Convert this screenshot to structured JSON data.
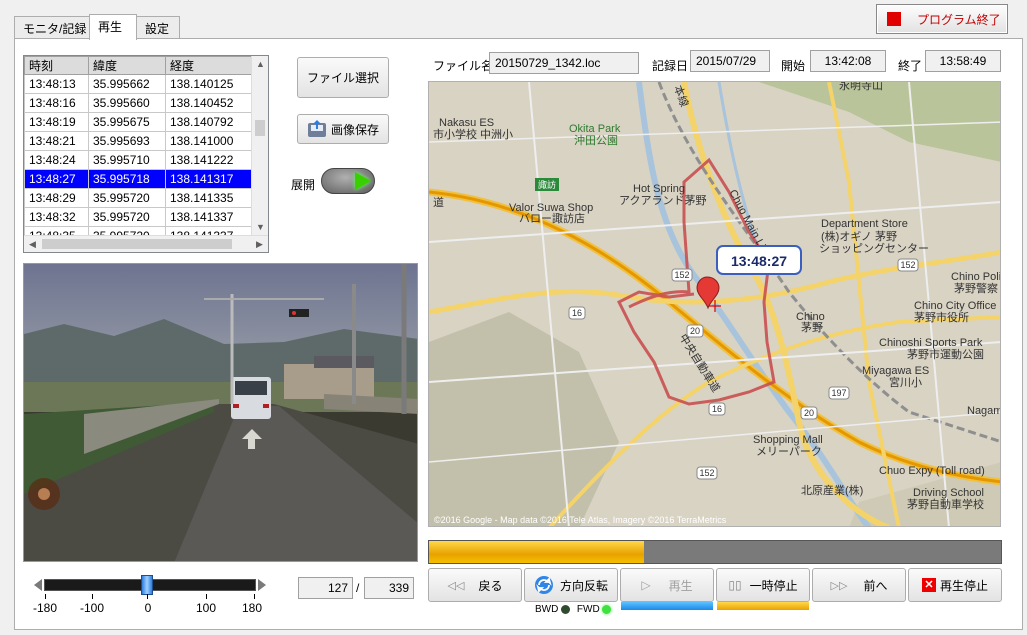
{
  "tabs": [
    {
      "label": "モニタ/記録",
      "active": false
    },
    {
      "label": "再生",
      "active": true
    },
    {
      "label": "設定",
      "active": false
    }
  ],
  "exit_button": {
    "label": "プログラム終了"
  },
  "grid": {
    "headers": [
      "時刻",
      "緯度",
      "経度"
    ],
    "rows": [
      [
        "13:48:13",
        "35.995662",
        "138.140125"
      ],
      [
        "13:48:16",
        "35.995660",
        "138.140452"
      ],
      [
        "13:48:19",
        "35.995675",
        "138.140792"
      ],
      [
        "13:48:21",
        "35.995693",
        "138.141000"
      ],
      [
        "13:48:24",
        "35.995710",
        "138.141222"
      ],
      [
        "13:48:27",
        "35.995718",
        "138.141317"
      ],
      [
        "13:48:29",
        "35.995720",
        "138.141335"
      ],
      [
        "13:48:32",
        "35.995720",
        "138.141337"
      ],
      [
        "13:48:35",
        "35.995720",
        "138.141337"
      ]
    ],
    "selected_index": 5
  },
  "buttons": {
    "file_select": "ファイル選択",
    "image_save": "画像保存",
    "expand_label": "展開"
  },
  "file_info": {
    "file_label": "ファイル名",
    "file_value": "20150729_1342.loc",
    "date_label": "記録日",
    "date_value": "2015/07/29",
    "start_label": "開始",
    "start_value": "13:42:08",
    "end_label": "終了",
    "end_value": "13:58:49"
  },
  "map": {
    "marker_time": "13:48:27",
    "copyright": "©2016 Google - Map data ©2016 Tele Atlas, Imagery ©2016 TerraMetrics",
    "labels": [
      {
        "text": "Nakasu ES"
      },
      {
        "text": "市小学校 中洲小"
      },
      {
        "text": "Okita Park"
      },
      {
        "text": "沖田公園"
      },
      {
        "text": "Hot Spring"
      },
      {
        "text": "アクアランド茅野"
      },
      {
        "text": "Valor Suwa Shop"
      },
      {
        "text": "バロー諏訪店"
      },
      {
        "text": "Department Store"
      },
      {
        "text": "(株)オギノ 茅野"
      },
      {
        "text": "ショッピングセンター"
      },
      {
        "text": "Chino Polic"
      },
      {
        "text": "茅野警察"
      },
      {
        "text": "Chino City Office"
      },
      {
        "text": "茅野市役所"
      },
      {
        "text": "Chino"
      },
      {
        "text": "茅野"
      },
      {
        "text": "Chinoshi Sports Park"
      },
      {
        "text": "茅野市運動公園"
      },
      {
        "text": "Miyagawa ES"
      },
      {
        "text": "宮川小"
      },
      {
        "text": "Nagami"
      },
      {
        "text": "Shopping Mall"
      },
      {
        "text": "メリーパーク"
      },
      {
        "text": "Chuo Expy (Toll road)"
      },
      {
        "text": "北原産業(株)"
      },
      {
        "text": "Driving School"
      },
      {
        "text": "茅野自動車学校"
      },
      {
        "text": "Chuo Main Li"
      },
      {
        "text": "中央自動車道"
      },
      {
        "text": "永明寺山"
      },
      {
        "text": "本線"
      },
      {
        "text": "道"
      },
      {
        "text": "諏訪"
      }
    ],
    "road_numbers": [
      "152",
      "16",
      "20",
      "197",
      "16",
      "20",
      "152",
      "152"
    ]
  },
  "slider": {
    "ticks": [
      "-180",
      "-100",
      "0",
      "100",
      "180"
    ],
    "value": 0
  },
  "frame": {
    "current": "127",
    "separator": "/",
    "total": "339"
  },
  "progress": {
    "fraction": 0.375
  },
  "controls": {
    "back": "戻る",
    "reverse": "方向反転",
    "play": "再生",
    "pause": "一時停止",
    "forward": "前へ",
    "stop": "再生停止"
  },
  "indicators": {
    "bwd": "BWD",
    "fwd": "FWD"
  }
}
